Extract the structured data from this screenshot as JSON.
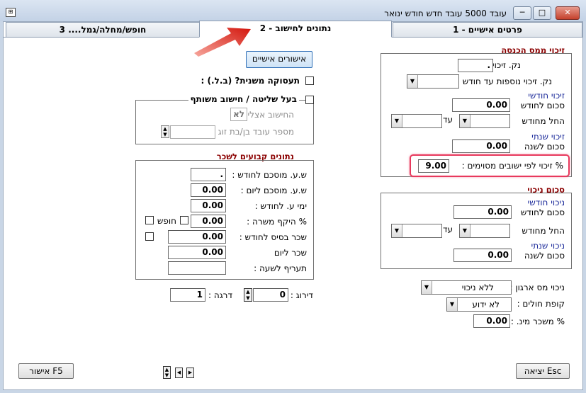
{
  "window": {
    "title": "עובד 5000 עובד חדש    חודש ינואר",
    "controls": {
      "minimize": "─",
      "maximize": "□",
      "close": "✕"
    }
  },
  "tabs": [
    {
      "label": "פרטים אישיים - 1"
    },
    {
      "label": "נתונים לחישוב - 2"
    },
    {
      "label": "חופש/מחלה/גמל.... 3"
    }
  ],
  "right": {
    "tax_credit": {
      "title": "זיכוי ממס הכנסה",
      "extra_points_label": "נק. זיכוי נוספות :",
      "extra_points_value": ".",
      "extra_until_label": "נק. זיכוי נוספות עד חודש :",
      "monthly_title": "זיכוי חודשי",
      "monthly_sum_label": "סכום לחודש",
      "monthly_sum_value": "0.00",
      "from_month_label": "החל מחודש",
      "until_label": "עד",
      "yearly_title": "זיכוי שנתי",
      "yearly_sum_label": "סכום לשנה",
      "yearly_sum_value": "0.00",
      "settlement_label": "% זיכוי לפי ישובים מסוימים :",
      "settlement_value": "9.00"
    },
    "deduction": {
      "title": "סכום ניכוי",
      "monthly_title": "ניכוי חודשי",
      "monthly_sum_label": "סכום לחודש",
      "monthly_sum_value": "0.00",
      "from_month_label": "החל מחודש",
      "until_label": "עד",
      "yearly_title": "ניכוי שנתי",
      "yearly_sum_label": "סכום לשנה",
      "yearly_sum_value": "0.00"
    },
    "org_tax_label": "ניכוי מס ארגון :",
    "org_tax_value": "ללא ניכוי",
    "health_fund_label": "קופת חולים :",
    "health_fund_value": "לא ידוע",
    "min_wage_label": "% משכר מינ. :",
    "min_wage_value": "0.00"
  },
  "left": {
    "personal_approvals_button": "אישורים אישיים",
    "secondary_job_label": "תעסוקה משנית? (ב.ל.) :",
    "controlling_label": "בעל שליטה / חישוב משותף",
    "calc_at_label": "החישוב אצלי :",
    "calc_at_value": "לא",
    "spouse_num_label": "מספר עובד בן/בת זוג :",
    "fixed": {
      "title": "נתונים קבועים לשכר",
      "avg_hours_month_label": "ש.ע. מוסכם לחודש :",
      "avg_hours_month_value": ".",
      "avg_hours_day_label": "ש.ע. מוסכם ליום :",
      "avg_hours_day_value": "0.00",
      "work_days_label": "ימי ע. לחודש :",
      "work_days_value": "0.00",
      "scope_label": "% היקף משרה :",
      "scope_value": "0.00",
      "vacation_label": "חופש",
      "base_salary_label": "שכר בסיס לחודש :",
      "base_salary_value": "0.00",
      "daily_wage_label": "שכר ליום",
      "daily_wage_value": "0.00",
      "hourly_rate_label": "תעריף לשעה :"
    },
    "rating_label": "דירוג :",
    "rating_value": "0",
    "grade_label": "דרגה :",
    "grade_value": "1"
  },
  "footer": {
    "approve_button": "אישור F5",
    "exit_button": "יציאה Esc"
  }
}
